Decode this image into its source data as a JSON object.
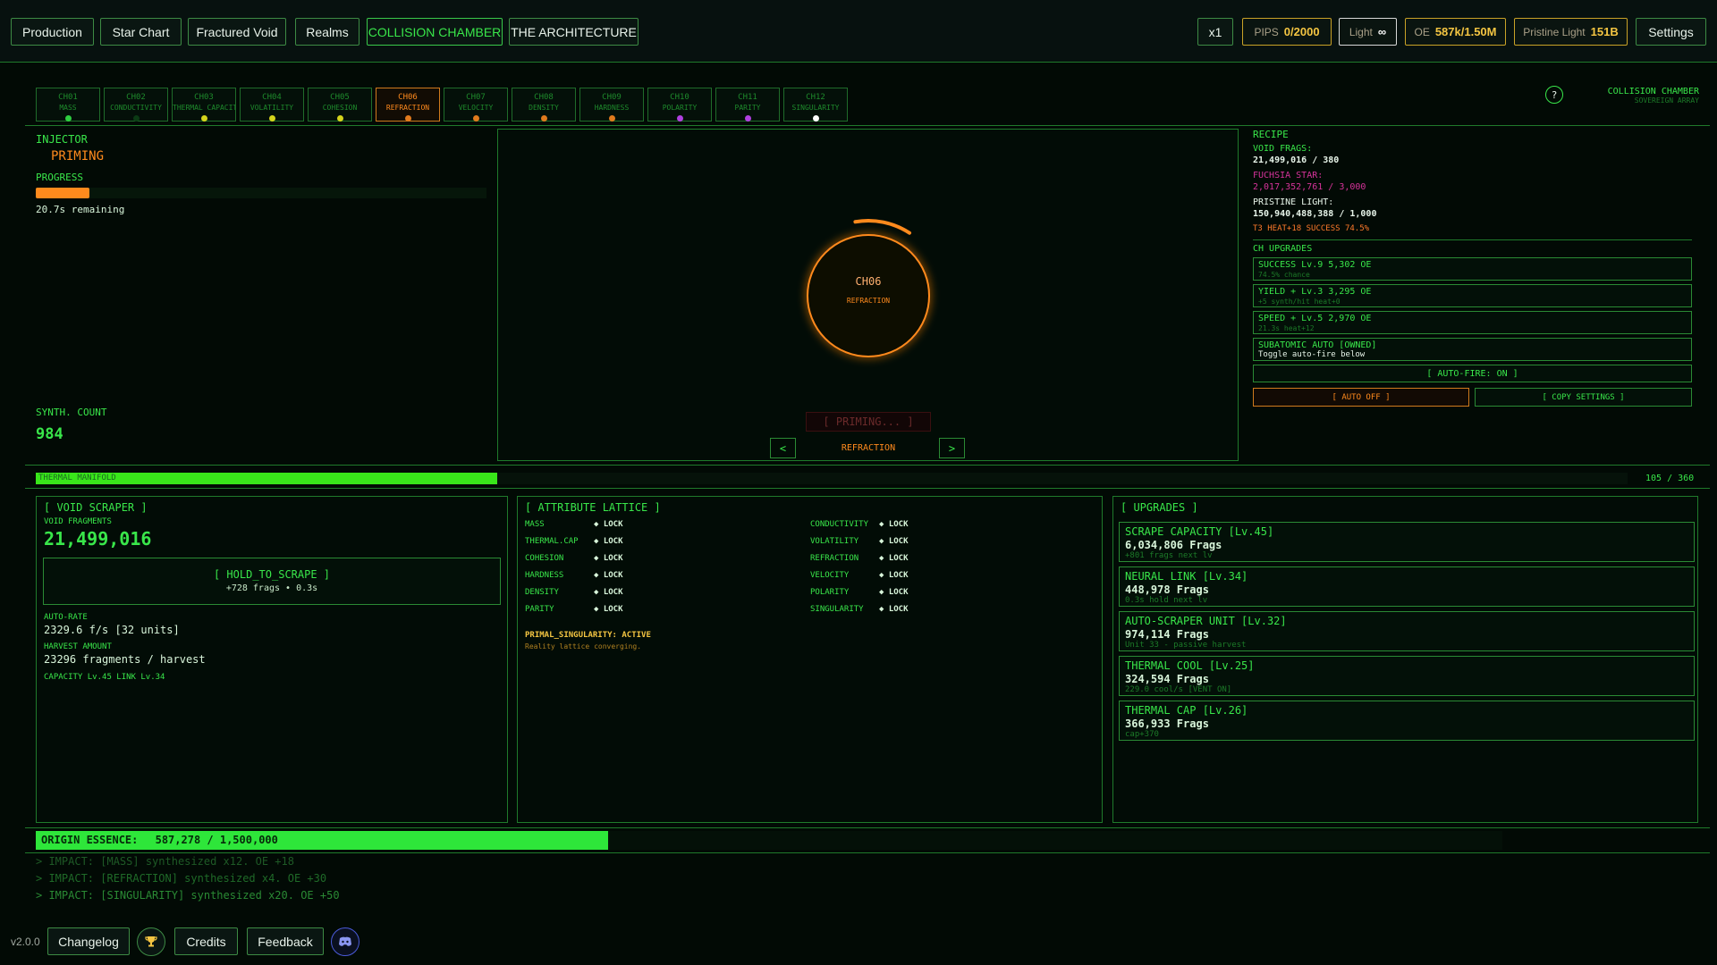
{
  "nav": {
    "tabs": [
      "Production",
      "Star Chart",
      "Fractured Void",
      "Realms",
      "COLLISION CHAMBER",
      "THE ARCHITECTURE"
    ],
    "speed": "x1",
    "pips_label": "PIPS",
    "pips_value": "0/2000",
    "light_label": "Light",
    "light_value": "∞",
    "oe_label": "OE",
    "oe_value": "587k/1.50M",
    "pristine_label": "Pristine Light",
    "pristine_value": "151B",
    "settings": "Settings"
  },
  "channels": [
    {
      "code": "CH01",
      "name": "MASS",
      "color": "#2ecc40"
    },
    {
      "code": "CH02",
      "name": "CONDUCTIVITY",
      "color": "#0b3a14"
    },
    {
      "code": "CH03",
      "name": "THERMAL CAPACITY",
      "color": "#d4d41c"
    },
    {
      "code": "CH04",
      "name": "VOLATILITY",
      "color": "#d4d41c"
    },
    {
      "code": "CH05",
      "name": "COHESION",
      "color": "#d4d41c"
    },
    {
      "code": "CH06",
      "name": "REFRACTION",
      "color": "#e07a1d"
    },
    {
      "code": "CH07",
      "name": "VELOCITY",
      "color": "#e07a1d"
    },
    {
      "code": "CH08",
      "name": "DENSITY",
      "color": "#e07a1d"
    },
    {
      "code": "CH09",
      "name": "HARDNESS",
      "color": "#e07a1d"
    },
    {
      "code": "CH10",
      "name": "POLARITY",
      "color": "#b040e0"
    },
    {
      "code": "CH11",
      "name": "PARITY",
      "color": "#b040e0"
    },
    {
      "code": "CH12",
      "name": "SINGULARITY",
      "color": "#ffffff"
    }
  ],
  "header_right": {
    "help": "?",
    "title": "COLLISION CHAMBER",
    "subtitle": "SOVEREIGN ARRAY"
  },
  "injector": {
    "label": "INJECTOR",
    "status": "PRIMING",
    "progress_label": "PROGRESS",
    "progress": 0.12,
    "remaining": "20.7s remaining",
    "synth_label": "SYNTH. COUNT",
    "synth_count": "984"
  },
  "chamber": {
    "code": "CH06",
    "name": "REFRACTION",
    "ring_progress": 0.12,
    "fire_button": "[ PRIMING... ]",
    "selector_label": "REFRACTION",
    "prev": "<",
    "next": ">"
  },
  "recipe": {
    "title": "RECIPE",
    "void_label": "VOID FRAGS:",
    "void_value": "21,499,016 / 380",
    "fuchsia_label": "FUCHSIA STAR:",
    "fuchsia_value": "2,017,352,761 / 3,000",
    "pristine_label": "PRISTINE LIGHT:",
    "pristine_value": "150,940,488,388 / 1,000",
    "tier_line": "T3  HEAT+18  SUCCESS 74.5%",
    "ch_upgrades": "CH UPGRADES",
    "upgrades": [
      {
        "title": "SUCCESS Lv.9  5,302 OE",
        "sub": "74.5% chance"
      },
      {
        "title": "YIELD + Lv.3  3,295 OE",
        "sub": "+5 synth/hit  heat+0"
      },
      {
        "title": "SPEED + Lv.5  2,970 OE",
        "sub": "21.3s  heat+12"
      },
      {
        "title": "SUBATOMIC AUTO  [OWNED]",
        "sub": "Toggle auto-fire below"
      }
    ],
    "autofire": "[ AUTO-FIRE: ON ]",
    "auto_off": "[ AUTO OFF ]",
    "copy_settings": "[ COPY SETTINGS ]"
  },
  "thermal": {
    "label": "THERMAL MANIFOLD",
    "value": "105 / 360",
    "fill": 0.29
  },
  "void_scraper": {
    "title": "[ VOID SCRAPER ]",
    "frag_label": "VOID FRAGMENTS",
    "frag_value": "21,499,016",
    "button_label": "[ HOLD_TO_SCRAPE ]",
    "button_sub": "+728 frags  •  0.3s",
    "auto_label": "AUTO-RATE",
    "auto_value": "2329.6 f/s  [32 units]",
    "harvest_label": "HARVEST AMOUNT",
    "harvest_value": "23296 fragments / harvest",
    "levels": "CAPACITY Lv.45  LINK Lv.34"
  },
  "lattice": {
    "title": "[ ATTRIBUTE LATTICE ]",
    "left": [
      {
        "name": "MASS",
        "value": "◆ LOCK"
      },
      {
        "name": "THERMAL.CAP",
        "value": "◆ LOCK"
      },
      {
        "name": "COHESION",
        "value": "◆ LOCK"
      },
      {
        "name": "HARDNESS",
        "value": "◆ LOCK"
      },
      {
        "name": "DENSITY",
        "value": "◆ LOCK"
      },
      {
        "name": "PARITY",
        "value": "◆ LOCK"
      }
    ],
    "right": [
      {
        "name": "CONDUCTIVITY",
        "value": "◆ LOCK"
      },
      {
        "name": "VOLATILITY",
        "value": "◆ LOCK"
      },
      {
        "name": "REFRACTION",
        "value": "◆ LOCK"
      },
      {
        "name": "VELOCITY",
        "value": "◆ LOCK"
      },
      {
        "name": "POLARITY",
        "value": "◆ LOCK"
      },
      {
        "name": "SINGULARITY",
        "value": "◆ LOCK"
      }
    ],
    "status": "PRIMAL_SINGULARITY: ACTIVE",
    "status_sub": "Reality lattice converging."
  },
  "upgrades": {
    "title": "[ UPGRADES ]",
    "items": [
      {
        "title": "SCRAPE CAPACITY  [Lv.45]",
        "cost": "6,034,806 Frags",
        "sub": "+801 frags next lv"
      },
      {
        "title": "NEURAL LINK  [Lv.34]",
        "cost": "448,978 Frags",
        "sub": "0.3s hold next lv"
      },
      {
        "title": "AUTO-SCRAPER UNIT  [Lv.32]",
        "cost": "974,114 Frags",
        "sub": "Unit 33 - passive harvest"
      },
      {
        "title": "THERMAL COOL  [Lv.25]",
        "cost": "324,594 Frags",
        "sub": "229.0 cool/s  [VENT ON]"
      },
      {
        "title": "THERMAL CAP  [Lv.26]",
        "cost": "366,933 Frags",
        "sub": "cap+370"
      }
    ]
  },
  "origin": {
    "label": "ORIGIN ESSENCE:",
    "value": "587,278 / 1,500,000",
    "fill": 0.39
  },
  "log": [
    "> IMPACT: [MASS] synthesized x12. OE +18",
    "> IMPACT: [REFRACTION] synthesized x4. OE +30",
    "> IMPACT: [SINGULARITY] synthesized x20. OE +50"
  ],
  "footer": {
    "version": "v2.0.0",
    "changelog": "Changelog",
    "credits": "Credits",
    "feedback": "Feedback"
  },
  "colors": {
    "accent": "#2ee63a",
    "orange": "#ff8a1d",
    "gold": "#f4c542",
    "fuchsia": "#d6339a",
    "bg": "#020a05"
  }
}
